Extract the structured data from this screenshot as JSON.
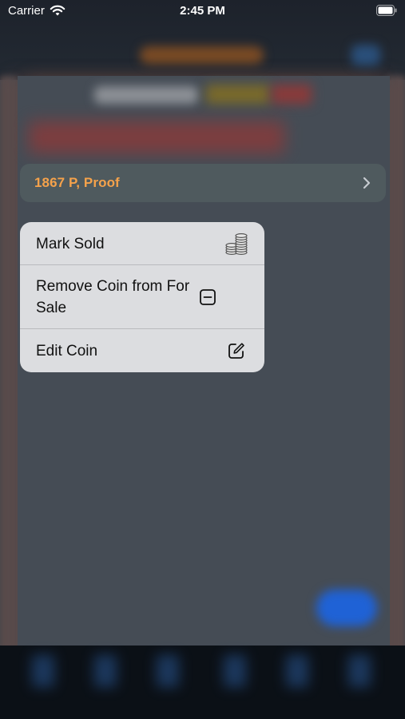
{
  "status_bar": {
    "carrier": "Carrier",
    "time": "2:45 PM",
    "wifi_icon": "wifi-icon",
    "battery_icon": "battery-icon"
  },
  "coin_row": {
    "title": "1867 P, Proof",
    "chevron_icon": "chevron-right-icon",
    "title_color": "#f5a24b"
  },
  "menu": {
    "items": [
      {
        "label": "Mark Sold",
        "icon": "coin-stack-icon"
      },
      {
        "label": "Remove Coin from For Sale",
        "icon": "minus-square-icon"
      },
      {
        "label": "Edit Coin",
        "icon": "edit-icon"
      }
    ]
  }
}
